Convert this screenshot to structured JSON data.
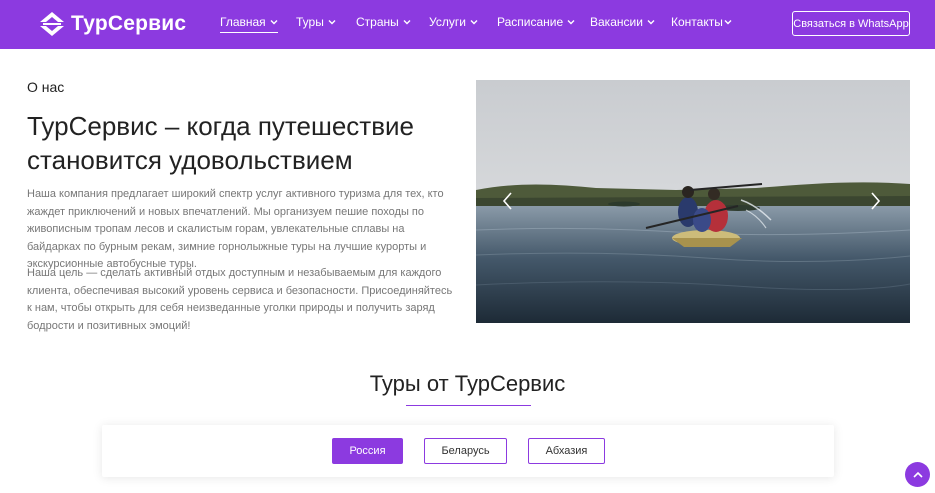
{
  "brand": {
    "name": "ТурСервис",
    "color": "#8c3ae0"
  },
  "nav": {
    "items": [
      {
        "label": "Главная",
        "active": true
      },
      {
        "label": "Туры"
      },
      {
        "label": "Страны"
      },
      {
        "label": "Услуги"
      },
      {
        "label": "Расписание"
      },
      {
        "label": "Вакансии"
      },
      {
        "label": "Контакты"
      }
    ],
    "cta": "Связаться в WhatsApp"
  },
  "about": {
    "kicker": "О нас",
    "title": "ТурСервис – когда путешествие становится удовольствием",
    "p1": "Наша компания предлагает широкий спектр услуг активного туризма для тех, кто жаждет приключений и новых впечатлений. Мы организуем пешие походы по живописным тропам лесов и скалистым горам, увлекательные сплавы на байдарках по бурным рекам, зимние горнолыжные туры на лучшие курорты и экскурсионные автобусные туры.",
    "p2": "Наша цель — сделать активный отдых доступным и незабываемым для каждого клиента, обеспечивая высокий уровень сервиса и безопасности. Присоединяйтесь к нам, чтобы открыть для себя неизведанные уголки природы и получить заряд бодрости и позитивных эмоций!"
  },
  "tours": {
    "title": "Туры от ТурСервис",
    "tabs": [
      {
        "label": "Россия",
        "active": true
      },
      {
        "label": "Беларусь"
      },
      {
        "label": "Абхазия"
      }
    ]
  },
  "icons": {
    "logo": "plane-globe-logo-icon",
    "nav_dropdown": "chevron-down-icon",
    "slider_prev": "chevron-left-icon",
    "slider_next": "chevron-right-icon",
    "scroll_top": "chevron-up-icon"
  }
}
